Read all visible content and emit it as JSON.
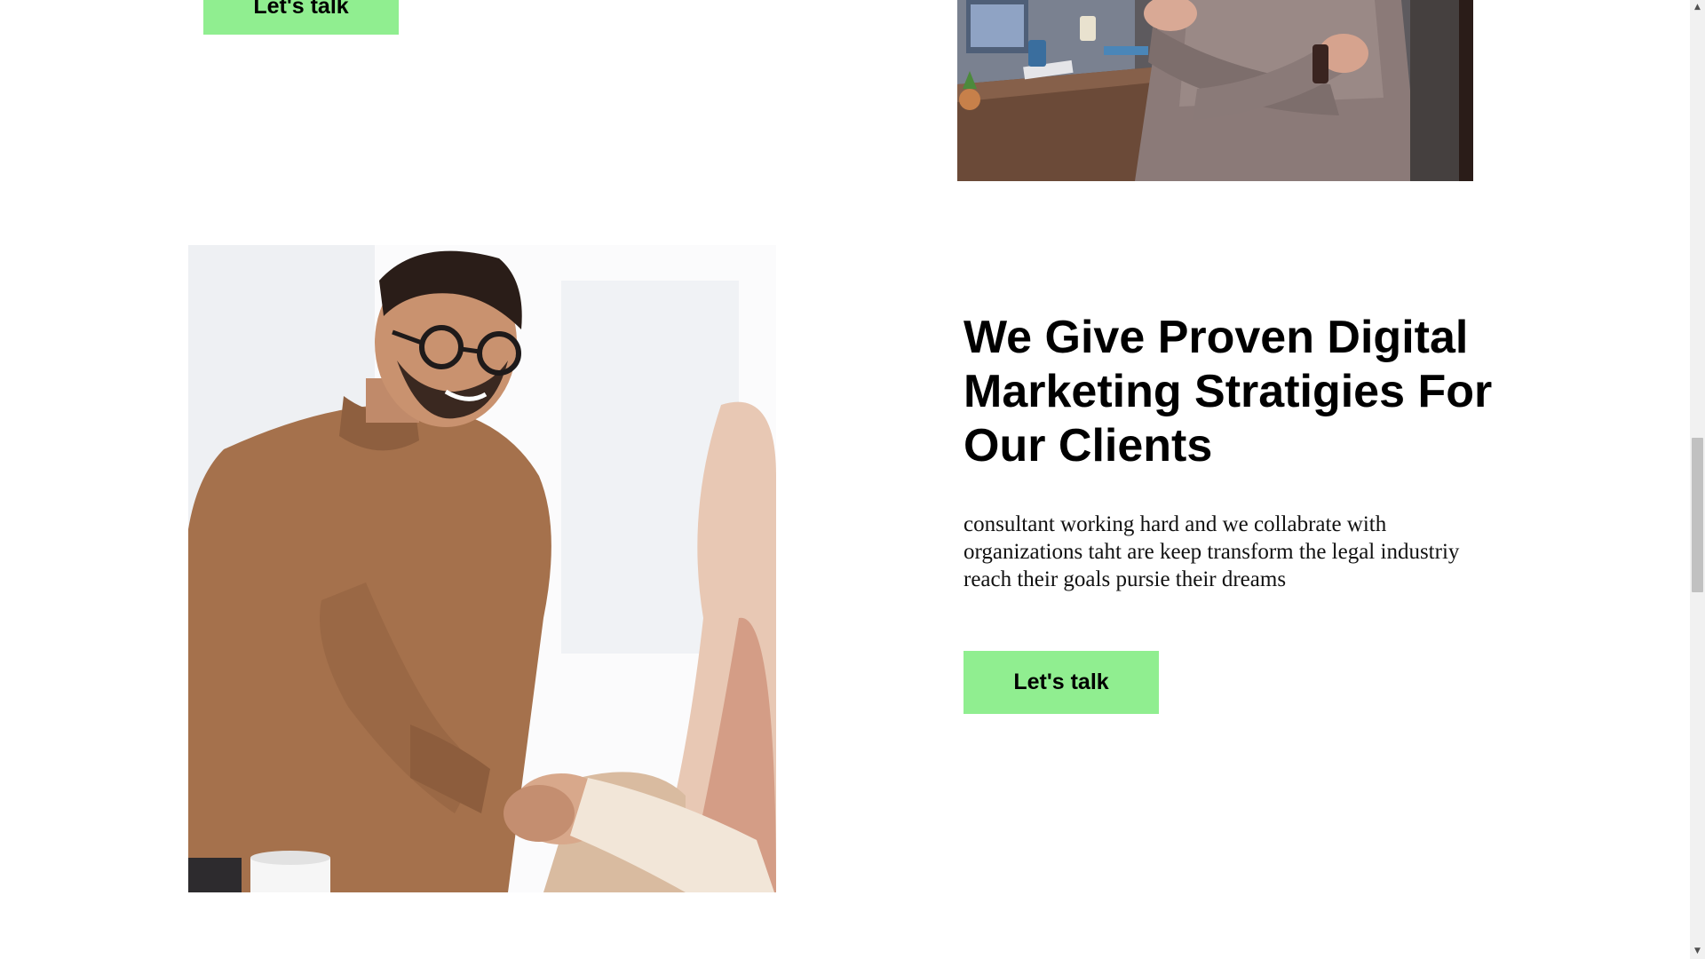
{
  "top_section": {
    "cta_label": "Let's talk"
  },
  "feature": {
    "title": "We Give Proven Digital Marketing Stratigies For Our Clients",
    "description": "consultant working hard and we collabrate with organizations taht are keep transform the legal industriy reach their goals pursie their dreams",
    "cta_label": "Let's talk"
  },
  "scrollbar": {
    "up_icon": "triangle-up-icon",
    "down_icon": "triangle-down-icon",
    "up_glyph": "▲",
    "down_glyph": "▼"
  },
  "colors": {
    "accent": "#90ee90",
    "text": "#000000",
    "background": "#ffffff"
  }
}
